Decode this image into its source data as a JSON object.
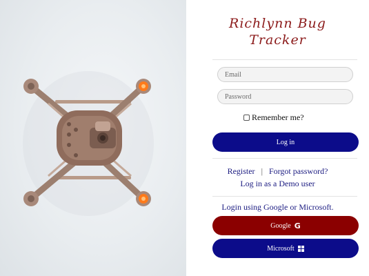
{
  "brand": {
    "title_line1": "Richlynn Bug",
    "title_line2": "Tracker"
  },
  "login_form": {
    "email_placeholder": "Email",
    "password_placeholder": "Password",
    "remember_label": "Remember me?",
    "login_button": "Log in"
  },
  "links": {
    "register": "Register",
    "separator": "|",
    "forgot_password": "Forgot password?",
    "demo": "Log in as a Demo user"
  },
  "oauth": {
    "heading": "Login using Google or Microsoft.",
    "google_button": "Google",
    "microsoft_button": "Microsoft"
  },
  "colors": {
    "brand_text": "#8b1a1a",
    "primary_button": "#0c0c8a",
    "google_button": "#8b0000",
    "link_text": "#1a1a80"
  },
  "icons": {
    "google": "google-g-icon",
    "microsoft": "windows-logo-icon",
    "hero_image": "drone-top-view"
  }
}
